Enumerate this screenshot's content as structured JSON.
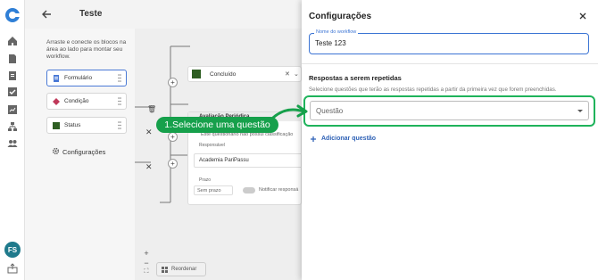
{
  "app": {
    "avatar_initials": "FS",
    "accent": "#3b74d4",
    "highlight": "#1fb35b",
    "callout_bg": "#16a04b"
  },
  "rail": {
    "icons": [
      "logo-icon",
      "home-icon",
      "document-icon",
      "report-icon",
      "checklist-icon",
      "chart-icon",
      "hierarchy-icon",
      "users-icon",
      "export-icon"
    ]
  },
  "workflow": {
    "title": "Teste",
    "hint": "Arraste e conecte os blocos na área ao lado para montar seu workflow.",
    "blocks": [
      {
        "label": "Formulário",
        "color": "#4a79d6"
      },
      {
        "label": "Condição",
        "color": "#c0395a"
      },
      {
        "label": "Status",
        "color": "#2e5e22"
      }
    ],
    "settings_label": "Configurações",
    "reorder_label": "Reordenar",
    "canvas": {
      "status_node": "Concluído",
      "form_title": "Avaliação Periódica",
      "form_note": "Este questionário não possui classificação",
      "responsible_label": "Responsável",
      "responsible_value": "Academia PariPassu",
      "deadline_label": "Prazo",
      "deadline_value": "Sem prazo",
      "notify_label": "Notificar responsá"
    }
  },
  "drawer": {
    "title": "Configurações",
    "workflow_name_label": "Nome do workflow",
    "workflow_name_value": "Teste 123",
    "section_title": "Respostas a serem repetidas",
    "section_desc": "Selecione questões que terão as respostas repetidas a partir da primeira vez que forem preenchidas.",
    "question_placeholder": "Questão",
    "add_question_label": "Adicionar questão"
  },
  "tutorial": {
    "callout": "1.Selecione uma questão"
  }
}
